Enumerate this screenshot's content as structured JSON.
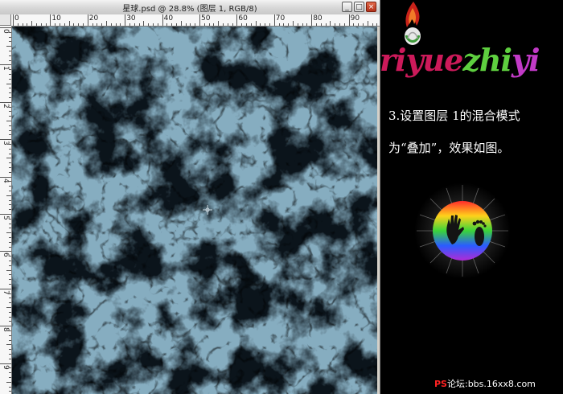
{
  "window": {
    "title": "星球.psd @ 28.8% (图层 1, RGB/8)",
    "minimize_label": "_",
    "maximize_label": "□",
    "close_label": "×"
  },
  "ruler": {
    "top_labels": [
      "0",
      "10",
      "20",
      "30",
      "40",
      "50",
      "60",
      "70",
      "80",
      "90"
    ],
    "left_labels": [
      "0",
      "1",
      "2",
      "3",
      "4",
      "5",
      "6",
      "7",
      "8",
      "9"
    ]
  },
  "logo": {
    "part1": "riyue",
    "part2": "zhi",
    "part3": "yi"
  },
  "caption": {
    "line1": "3.设置图层 1的混合模式",
    "line2": "为“叠加”，效果如图。"
  },
  "footer": {
    "brand": "PS",
    "text": "论坛:bbs.16xx8.com"
  },
  "colors": {
    "canvas_base": "#0b141b",
    "cloud": "#3d6a86",
    "logo_red": "#cc1a5a",
    "logo_green": "#5ecf3f",
    "logo_purple": "#c23ac7"
  }
}
